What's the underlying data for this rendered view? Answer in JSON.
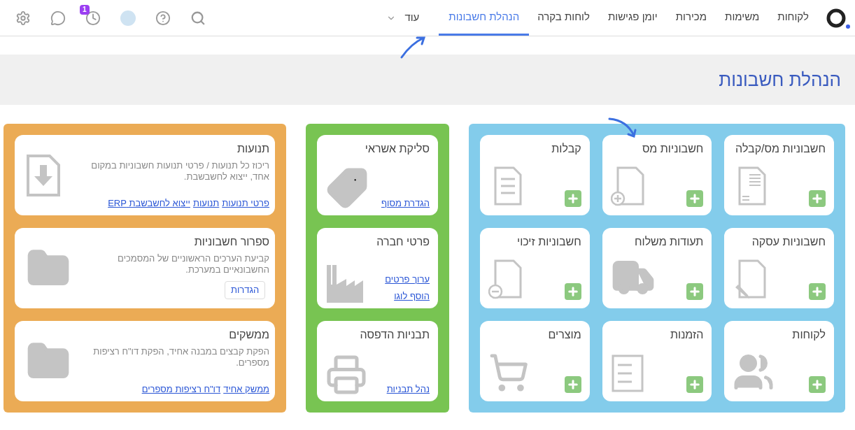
{
  "nav": {
    "items": [
      {
        "label": "לקוחות",
        "selected": false
      },
      {
        "label": "משימות",
        "selected": false
      },
      {
        "label": "מכירות",
        "selected": false
      },
      {
        "label": "יומן פגישות",
        "selected": false
      },
      {
        "label": "לוחות בקרה",
        "selected": false
      },
      {
        "label": "הנהלת חשבונות",
        "selected": true
      }
    ],
    "more": "עוד",
    "notification_count": "1"
  },
  "page_title": "הנהלת חשבונות",
  "panels": [
    {
      "kind": "grid",
      "color": "#83cceb",
      "cards": [
        {
          "title": "חשבוניות מס/קבלה",
          "add_button": true
        },
        {
          "title": "חשבוניות מס",
          "add_button": true
        },
        {
          "title": "קבלות",
          "add_button": true
        },
        {
          "title": "חשבוניות עסקה",
          "add_button": true
        },
        {
          "title": "תעודות משלוח",
          "add_button": true
        },
        {
          "title": "חשבוניות זיכוי",
          "add_button": true
        },
        {
          "title": "לקוחות",
          "add_button": true
        },
        {
          "title": "הזמנות",
          "add_button": true
        },
        {
          "title": "מוצרים",
          "add_button": true
        }
      ]
    },
    {
      "kind": "stack",
      "color": "#78c452",
      "cards": [
        {
          "title": "סליקת אשראי",
          "links": [
            "הגדרת מסוף"
          ]
        },
        {
          "title": "פרטי חברה",
          "links": [
            "ערוך פרטים",
            "הוסף לוגו"
          ]
        },
        {
          "title": "תבניות הדפסה",
          "links": [
            "נהל תבניות"
          ]
        }
      ]
    },
    {
      "kind": "list",
      "color": "#ebab55",
      "cards": [
        {
          "title": "תנועות",
          "description": "ריכוז כל תנועות / פרטי תנועות חשבוניות במקום אחד, ייצוא לחשבשבת.",
          "links": [
            "פרטי תנועות",
            "תנועות",
            "ייצוא לחשבשבת ERP"
          ]
        },
        {
          "title": "ספרור חשבוניות",
          "description": "קביעת הערכים הראשוניים של המסמכים החשבונאיים במערכת.",
          "button": "הגדרות"
        },
        {
          "title": "ממשקים",
          "description": "הפקת קבצים במבנה אחיד, הפקת דו\"ח רציפות מספרים.",
          "links": [
            "ממשק אחיד",
            "דו\"ח רציפות מספרים"
          ]
        }
      ]
    }
  ]
}
